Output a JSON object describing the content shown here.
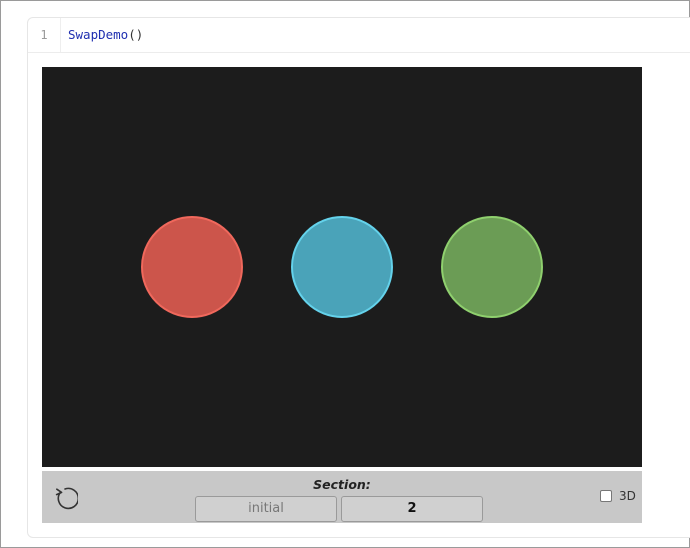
{
  "cell": {
    "line_number": "1",
    "code_function": "SwapDemo",
    "code_args": "()"
  },
  "scene": {
    "background": "#1c1c1c",
    "circles": [
      {
        "name": "red-circle",
        "fill": "#cc554b",
        "stroke": "#f0685c"
      },
      {
        "name": "blue-circle",
        "fill": "#4aa3b9",
        "stroke": "#64d2eb"
      },
      {
        "name": "green-circle",
        "fill": "#6b9c55",
        "stroke": "#8fd06e"
      }
    ]
  },
  "controls": {
    "replay_icon": "replay-icon",
    "section_label": "Section:",
    "sections": [
      "initial",
      "2"
    ],
    "active_section": "2",
    "toggle_3d_label": "3D",
    "toggle_3d_checked": false
  }
}
